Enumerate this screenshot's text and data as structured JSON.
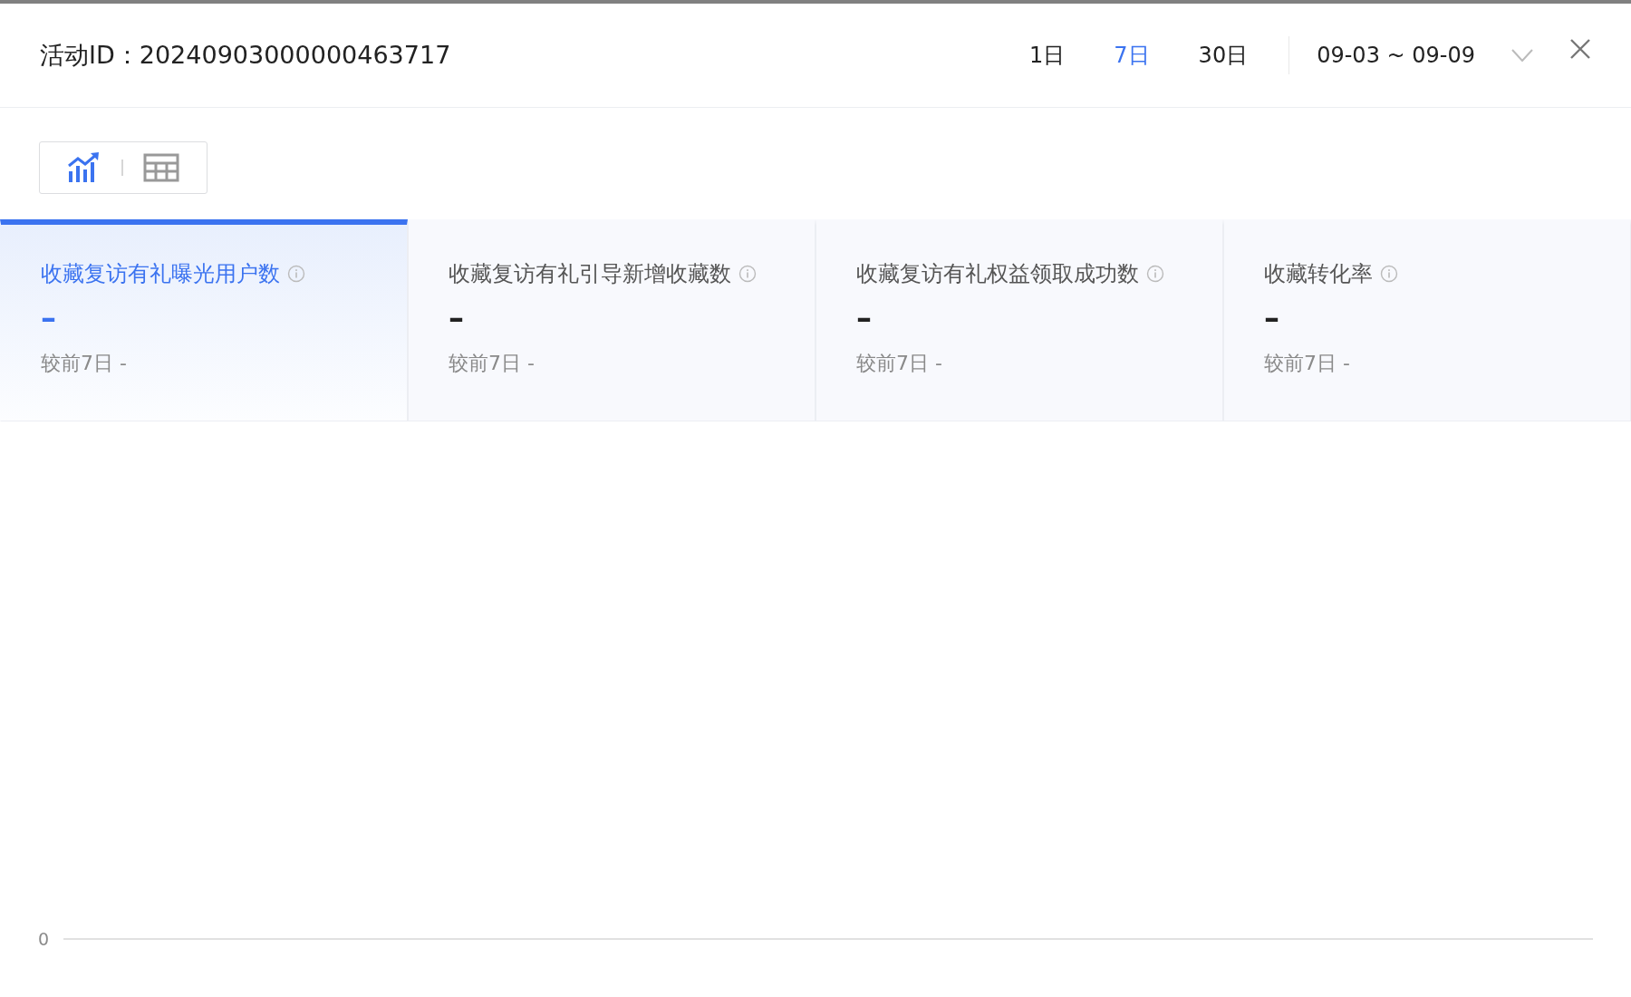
{
  "header": {
    "title": "活动ID：20240903000000463717",
    "periods": [
      {
        "label": "1日",
        "selected": false
      },
      {
        "label": "7日",
        "selected": true
      },
      {
        "label": "30日",
        "selected": false
      }
    ],
    "date_range": "09-03 ~ 09-09"
  },
  "view_toggle": [
    {
      "kind": "chart",
      "selected": true
    },
    {
      "kind": "table",
      "selected": false
    }
  ],
  "metrics": [
    {
      "title": "收藏复访有礼曝光用户数",
      "value": "–",
      "compare": "较前7日 -",
      "selected": true
    },
    {
      "title": "收藏复访有礼引导新增收藏数",
      "value": "–",
      "compare": "较前7日 -",
      "selected": false
    },
    {
      "title": "收藏复访有礼权益领取成功数",
      "value": "–",
      "compare": "较前7日 -",
      "selected": false
    },
    {
      "title": "收藏转化率",
      "value": "–",
      "compare": "较前7日 -",
      "selected": false
    }
  ],
  "chart": {
    "y_tick": "0"
  }
}
